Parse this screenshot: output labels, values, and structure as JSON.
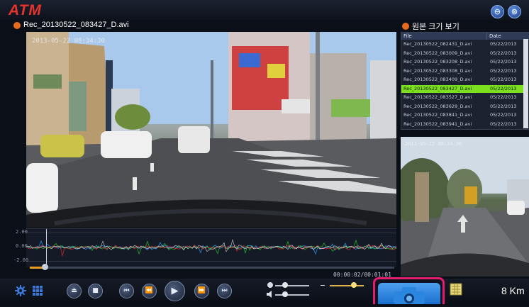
{
  "app": {
    "logo": "ATM",
    "minimize_glyph": "⊖",
    "close_glyph": "⊗"
  },
  "player": {
    "filename": "Rec_20130522_083427_D.avi",
    "main_timestamp": "2013-05-22 08:34:30",
    "side_timestamp": "2013-05-22 08:34:30",
    "timecode": "00:00:02/00:01:01",
    "speed": "8 Km",
    "progress_fraction": 0.04
  },
  "graph": {
    "labels": [
      "2.00",
      "0.00",
      "-2.00"
    ],
    "series_colors": [
      "#2fa0ff",
      "#29c42b",
      "#e4262b",
      "#f2f2f2"
    ]
  },
  "file_panel": {
    "title": "원본 크기 보기",
    "col_file": "File",
    "col_date": "Date",
    "rows": [
      {
        "file": "Rec_20130522_082431_D.avi",
        "date": "05/22/2013"
      },
      {
        "file": "Rec_20130522_083009_D.avi",
        "date": "05/22/2013"
      },
      {
        "file": "Rec_20130522_083208_D.avi",
        "date": "05/22/2013"
      },
      {
        "file": "Rec_20130522_083308_D.avi",
        "date": "05/22/2013"
      },
      {
        "file": "Rec_20130522_083409_D.avi",
        "date": "05/22/2013"
      },
      {
        "file": "Rec_20130522_083427_D.avi",
        "date": "05/22/2013",
        "selected": true
      },
      {
        "file": "Rec_20130522_083527_D.avi",
        "date": "05/22/2013"
      },
      {
        "file": "Rec_20130522_083629_D.avi",
        "date": "05/22/2013"
      },
      {
        "file": "Rec_20130522_083841_D.avi",
        "date": "05/22/2013"
      },
      {
        "file": "Rec_20130522_083941_D.avi",
        "date": "05/22/2013"
      }
    ]
  },
  "controls": {
    "settings_icon": "gear-icon",
    "grid_icon": "grid-icon",
    "eject_glyph": "⏏",
    "stop_glyph": "■",
    "first_glyph": "⏮",
    "rewind_glyph": "⏪",
    "play_glyph": "▶",
    "forward_glyph": "⏩",
    "last_glyph": "⏭",
    "volume_level": 0.3,
    "balance_level": 0.3
  },
  "colors": {
    "accent_orange": "#e89a1a",
    "selection_green": "#7de01e",
    "highlight_pink": "#e51d6e",
    "camera_blue": "#2b86e0"
  }
}
